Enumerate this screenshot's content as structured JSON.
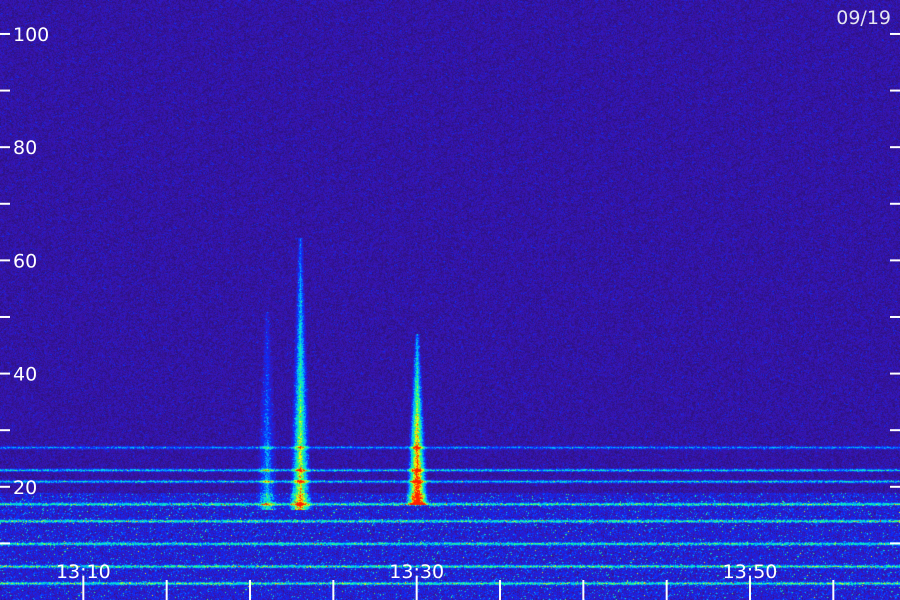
{
  "chart_data": {
    "type": "heatmap",
    "title": "",
    "date_label": "09/19",
    "xlabel": "",
    "ylabel": "",
    "ylim": [
      0,
      106
    ],
    "y_tick_labels": [
      "100",
      "80",
      "60",
      "40",
      "20"
    ],
    "y_tick_values": [
      100,
      80,
      60,
      40,
      20
    ],
    "y_minor_tick_values": [
      90,
      70,
      50,
      30,
      10
    ],
    "x_range_minutes": [
      "13:05",
      "13:59"
    ],
    "x_tick_labels": [
      "13:10",
      "13:30",
      "13:50"
    ],
    "x_tick_times": [
      "13:10",
      "13:30",
      "13:50"
    ],
    "x_minor_tick_times": [
      "13:15",
      "13:20",
      "13:25",
      "13:35",
      "13:40",
      "13:45",
      "13:55"
    ],
    "colormap": [
      "#24115c",
      "#3a14b0",
      "#0a2cff",
      "#00c8ff",
      "#20ff80",
      "#ffff00",
      "#ff2000"
    ],
    "bursts": [
      {
        "time": "13:21",
        "f_low": 17,
        "f_high": 51,
        "peak": 0.35
      },
      {
        "time": "13:23",
        "f_low": 17,
        "f_high": 64,
        "peak": 0.72
      },
      {
        "time": "13:30",
        "f_low": 18,
        "f_high": 47,
        "peak": 1.0
      }
    ],
    "interference_bands": [
      27,
      23,
      21,
      17,
      14,
      10,
      6,
      3
    ]
  }
}
